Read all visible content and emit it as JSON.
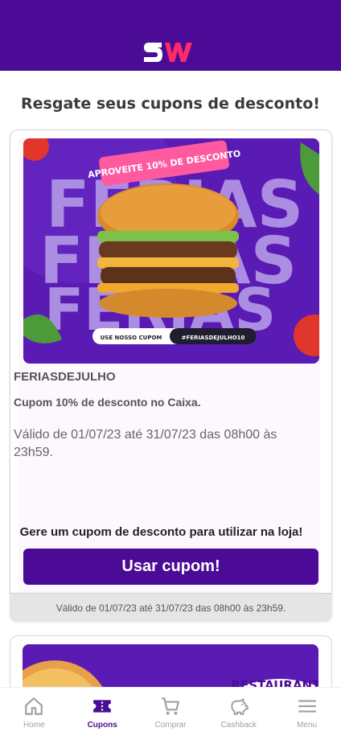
{
  "header": {
    "logo_text": "SW",
    "brand_color": "#4b0b96",
    "logo_accent": "#ff2a68"
  },
  "page": {
    "title": "Resgate seus cupons de desconto!"
  },
  "coupon": {
    "banner": {
      "headline": "APROVEITE 10% DE DESCONTO",
      "word": "FERIAS",
      "cta_prefix": "USE NOSSO CUPOM",
      "cta_code": "#FERIASDEJULHO10"
    },
    "code": "FERIASDEJULHO",
    "description": "Cupom 10% de desconto no Caixa.",
    "validity": "Válido de 01/07/23 até 31/07/23 das 08h00 às 23h59.",
    "generate_text": "Gere um cupom de desconto para utilizar na loja!",
    "button_label": "Usar cupom!",
    "footer_validity": "Válido de 01/07/23 até 31/07/23 das 08h00 às 23h59."
  },
  "coupon2": {
    "banner_text": "RESTAURANTE"
  },
  "nav": {
    "items": [
      {
        "label": "Home",
        "icon": "home-icon"
      },
      {
        "label": "Cupons",
        "icon": "ticket-icon",
        "active": true
      },
      {
        "label": "Comprar",
        "icon": "cart-icon"
      },
      {
        "label": "Cashback",
        "icon": "piggy-bank-icon"
      },
      {
        "label": "Menu",
        "icon": "menu-icon"
      }
    ]
  }
}
